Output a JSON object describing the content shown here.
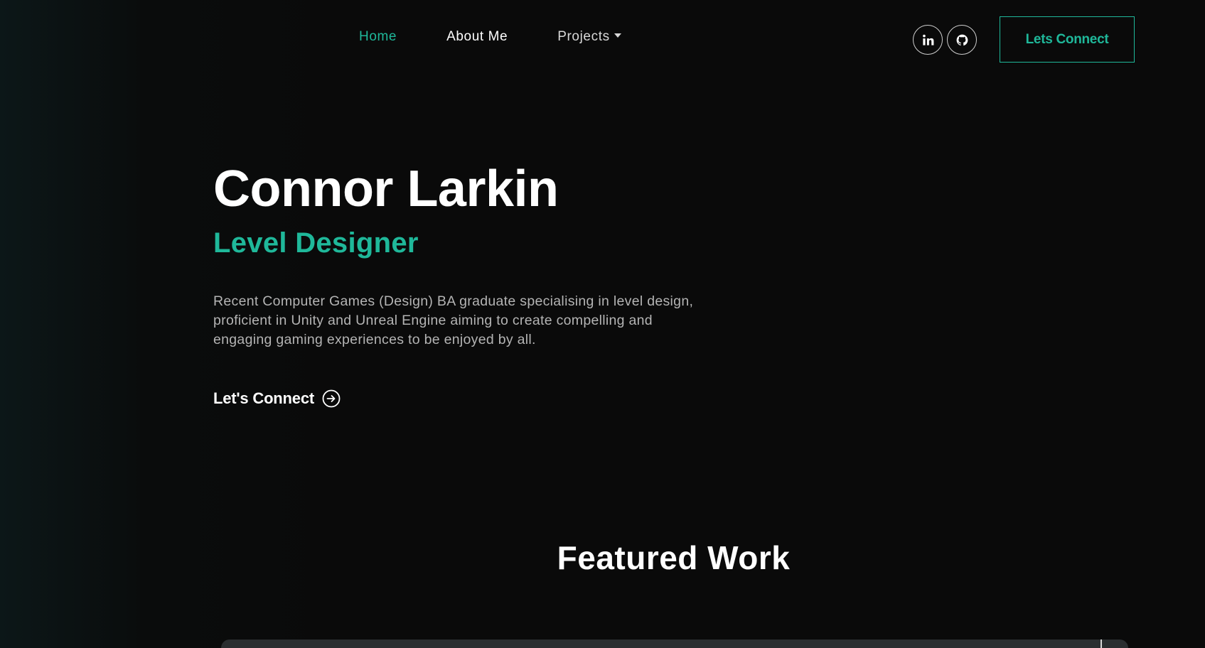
{
  "nav": {
    "links": [
      {
        "label": "Home",
        "active": true
      },
      {
        "label": "About Me",
        "active": false
      },
      {
        "label": "Projects",
        "active": false,
        "has_dropdown": true
      }
    ],
    "social": [
      {
        "label": "in",
        "icon": "linkedin-icon"
      },
      {
        "label": "",
        "icon": "github-icon"
      }
    ],
    "cta_label": "Lets Connect"
  },
  "hero": {
    "name": "Connor Larkin",
    "role": "Level Designer",
    "description": "Recent Computer Games (Design) BA graduate specialising in level design, proficient in Unity and Unreal Engine aiming to create compelling and engaging gaming experiences to be enjoyed by all.",
    "cta_label": "Let's Connect",
    "cta_icon": "arrow-right-circle-icon"
  },
  "featured": {
    "title": "Featured Work"
  },
  "colors": {
    "accent": "#1fb89a",
    "background": "#0a0a0a",
    "text": "#ffffff",
    "muted_text": "#b4b4b4"
  }
}
